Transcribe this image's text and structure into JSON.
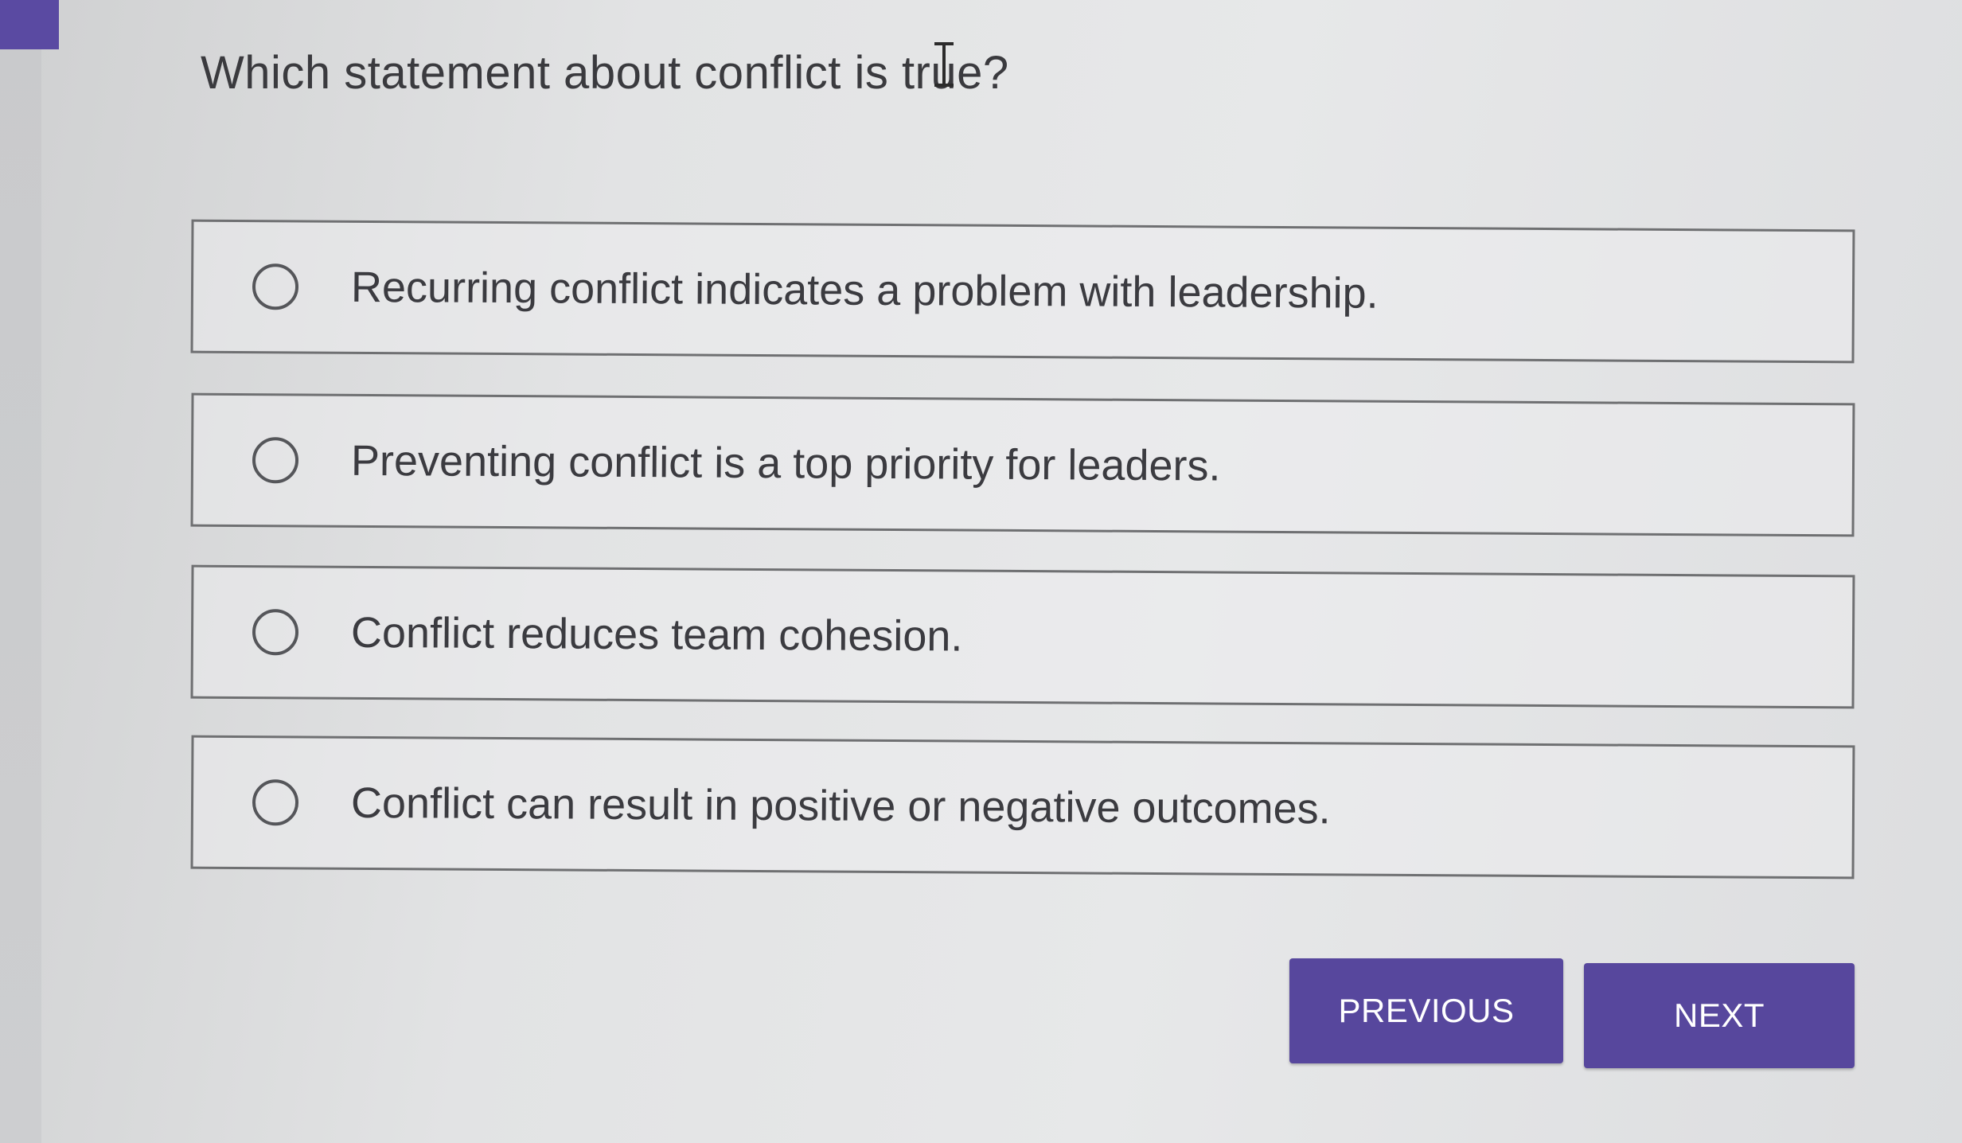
{
  "question": {
    "text_before_cursor": "Which statement about conflict is tru",
    "text_after_cursor": "e?"
  },
  "options": [
    {
      "label": "Recurring conflict indicates a problem with leadership.",
      "selected": false
    },
    {
      "label": "Preventing conflict is a top priority for leaders.",
      "selected": false
    },
    {
      "label": "Conflict reduces team cohesion.",
      "selected": false
    },
    {
      "label": "Conflict can result in positive or negative outcomes.",
      "selected": false
    }
  ],
  "navigation": {
    "previous_label": "PREVIOUS",
    "next_label": "NEXT"
  },
  "colors": {
    "accent": "#57479d",
    "background": "#e4e5e6",
    "text": "#3b3b40",
    "border": "#6f7072"
  },
  "icons": {
    "cursor": "text-cursor-icon",
    "radio": "radio-unselected-icon"
  }
}
